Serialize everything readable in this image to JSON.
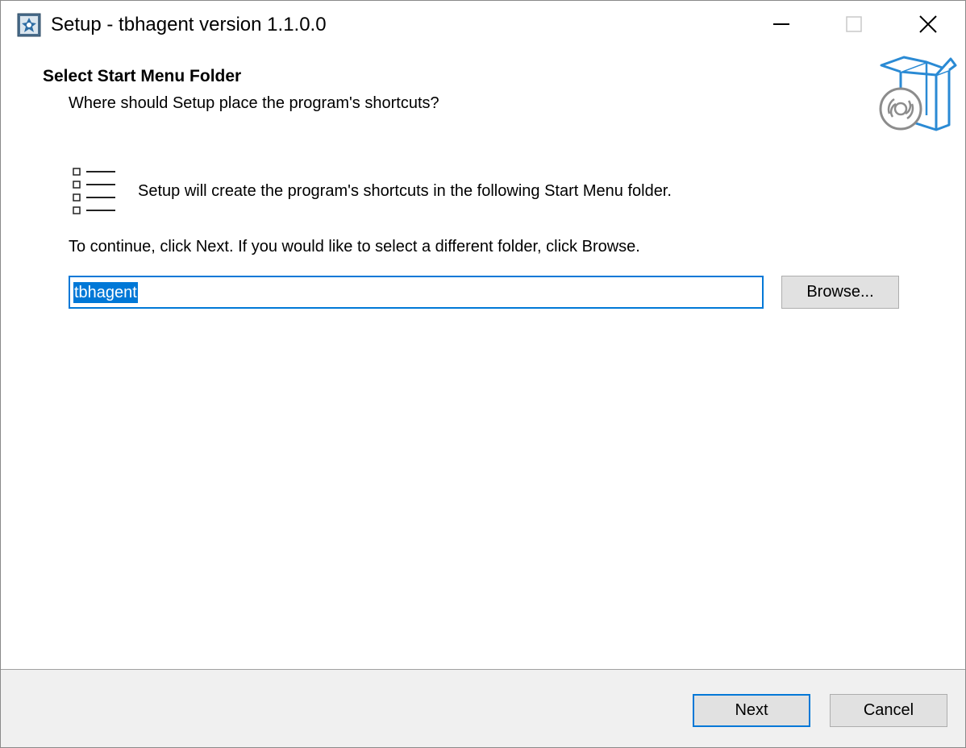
{
  "window": {
    "title": "Setup - tbhagent version 1.1.0.0",
    "app_icon": "setup-icon"
  },
  "caption_buttons": {
    "minimize_icon": "minimize-icon",
    "maximize_icon": "maximize-icon",
    "close_icon": "close-icon"
  },
  "header": {
    "title": "Select Start Menu Folder",
    "subtitle": "Where should Setup place the program's shortcuts?",
    "graphic_icon": "install-box-icon"
  },
  "body": {
    "intro": "Setup will create the program's shortcuts in the following Start Menu folder.",
    "instruction": "To continue, click Next. If you would like to select a different folder, click Browse.",
    "list_icon": "list-icon",
    "folder_value": "tbhagent",
    "browse_label": "Browse..."
  },
  "footer": {
    "next_label": "Next",
    "cancel_label": "Cancel"
  },
  "colors": {
    "accent": "#0078d7",
    "footer_bg": "#f0f0f0",
    "button_bg": "#e1e1e1",
    "graphic_blue": "#2a8ad4"
  }
}
